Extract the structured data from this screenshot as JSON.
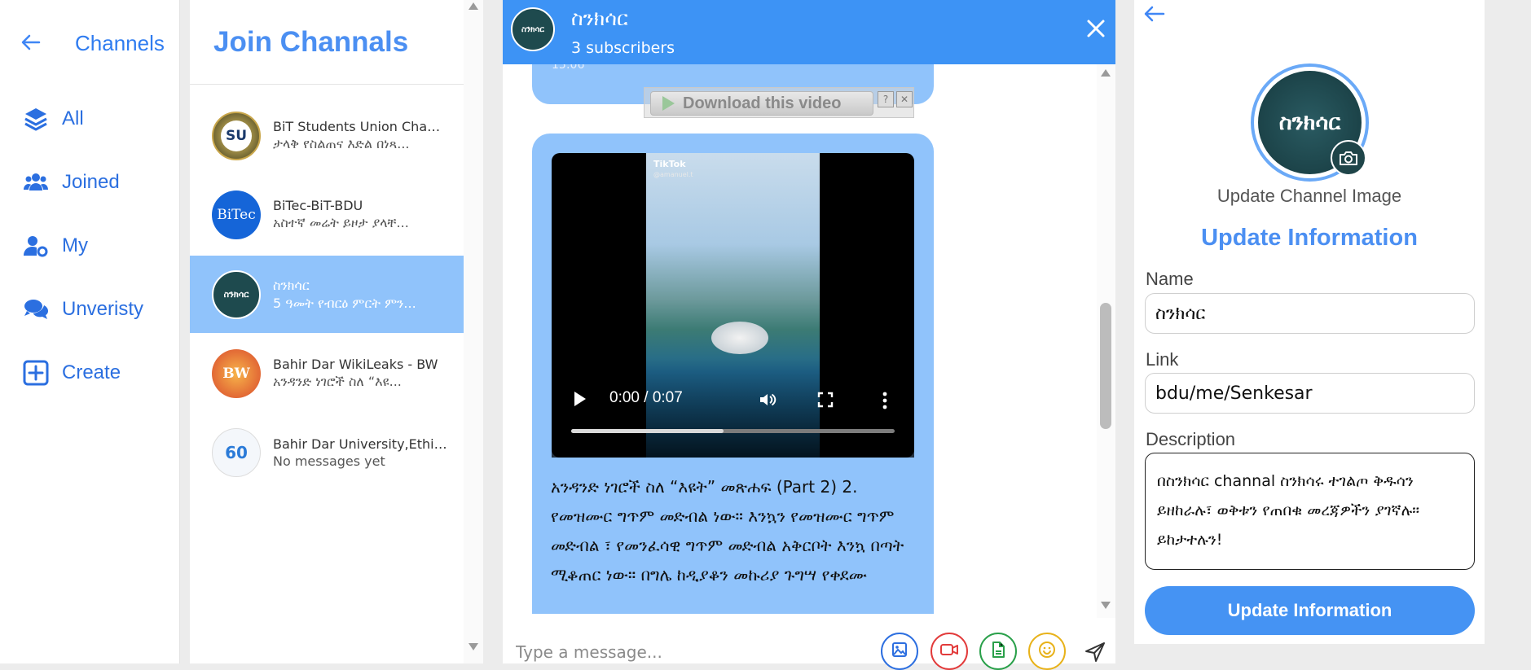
{
  "nav": {
    "title": "Channels",
    "items": [
      {
        "label": "All",
        "icon": "layers-icon"
      },
      {
        "label": "Joined",
        "icon": "users-icon"
      },
      {
        "label": "My",
        "icon": "user-gear-icon"
      },
      {
        "label": "Unveristy",
        "icon": "chat-bubbles-icon"
      },
      {
        "label": "Create",
        "icon": "plus-square-icon"
      }
    ],
    "accent": "#2b6fe0"
  },
  "list": {
    "title": "Join Channals",
    "channels": [
      {
        "name": "BiT Students Union Channel",
        "preview": "ታላቅ የስልጠና እድል በነጻ...",
        "avatar_text": "SU",
        "active": false
      },
      {
        "name": "BiTec-BiT-BDU",
        "preview": "አስተኛ መሬት ይዞታ ያላቸ...",
        "avatar_text": "BiTec",
        "active": false
      },
      {
        "name": "ስንክሳር",
        "preview": "5 ዓመት የብርዕ ምርት ምን...",
        "avatar_text": "ስንክሳር",
        "active": true
      },
      {
        "name": "Bahir Dar WikiLeaks - BW",
        "preview": "አንዳንድ ነገሮች ስለ “እዩ...",
        "avatar_text": "BW",
        "active": false
      },
      {
        "name": "Bahir Dar University,Ethiopia",
        "preview": "No messages yet",
        "avatar_text": "60",
        "active": false
      }
    ],
    "active_color": "#90c3fb"
  },
  "chat": {
    "name": "ስንክሳር",
    "subscribers": "3 subscribers",
    "avatar_text": "ስንክሳር",
    "header_color": "#3d93f5",
    "prev_time": "15:06",
    "download_label": "Download this video",
    "download_help": "?",
    "download_close": "✕",
    "video": {
      "brand": "TikTok",
      "user": "@amanuel.t",
      "time": "0:00 / 0:07",
      "progress": 0.47
    },
    "message": "አንዳንድ ነገሮች ስለ “እዩት” መጽሐፍ  (Part 2)   2. የመዝሙር ግጥም መድብል ነው።  እንኳን የመዝሙር ግጥም መድብል ፣ የመንፈሳዊ ግጥም መድብል አቅርቦት እንኳ በጣት ሚቆጠር ነው። በግሌ ከዲያቆን መኩሪያ ጉግሣ የቀደሙ",
    "composer_placeholder": "Type a message...",
    "composer_buttons": [
      {
        "icon": "image-icon",
        "color": "#2d6fe0"
      },
      {
        "icon": "video-icon",
        "color": "#e23b3b"
      },
      {
        "icon": "file-icon",
        "color": "#2aa04a"
      },
      {
        "icon": "emoji-icon",
        "color": "#e8b21a"
      }
    ]
  },
  "panel": {
    "image_label": "Update Channel Image",
    "title": "Update Information",
    "name_label": "Name",
    "name_value": "ስንክሳር",
    "link_label": "Link",
    "link_value": "bdu/me/Senkesar",
    "description_label": "Description",
    "description_value": "በስንክሳር channal ስንክሳሩ ተገልጦ ቅዱሳን ይዘከራሉ፣ ወቅቱን የጠበቁ መረጃዎችን ያገኛሉ። ይከታተሉን!",
    "submit_label": "Update Information",
    "avatar_text": "ስንክሳር"
  }
}
